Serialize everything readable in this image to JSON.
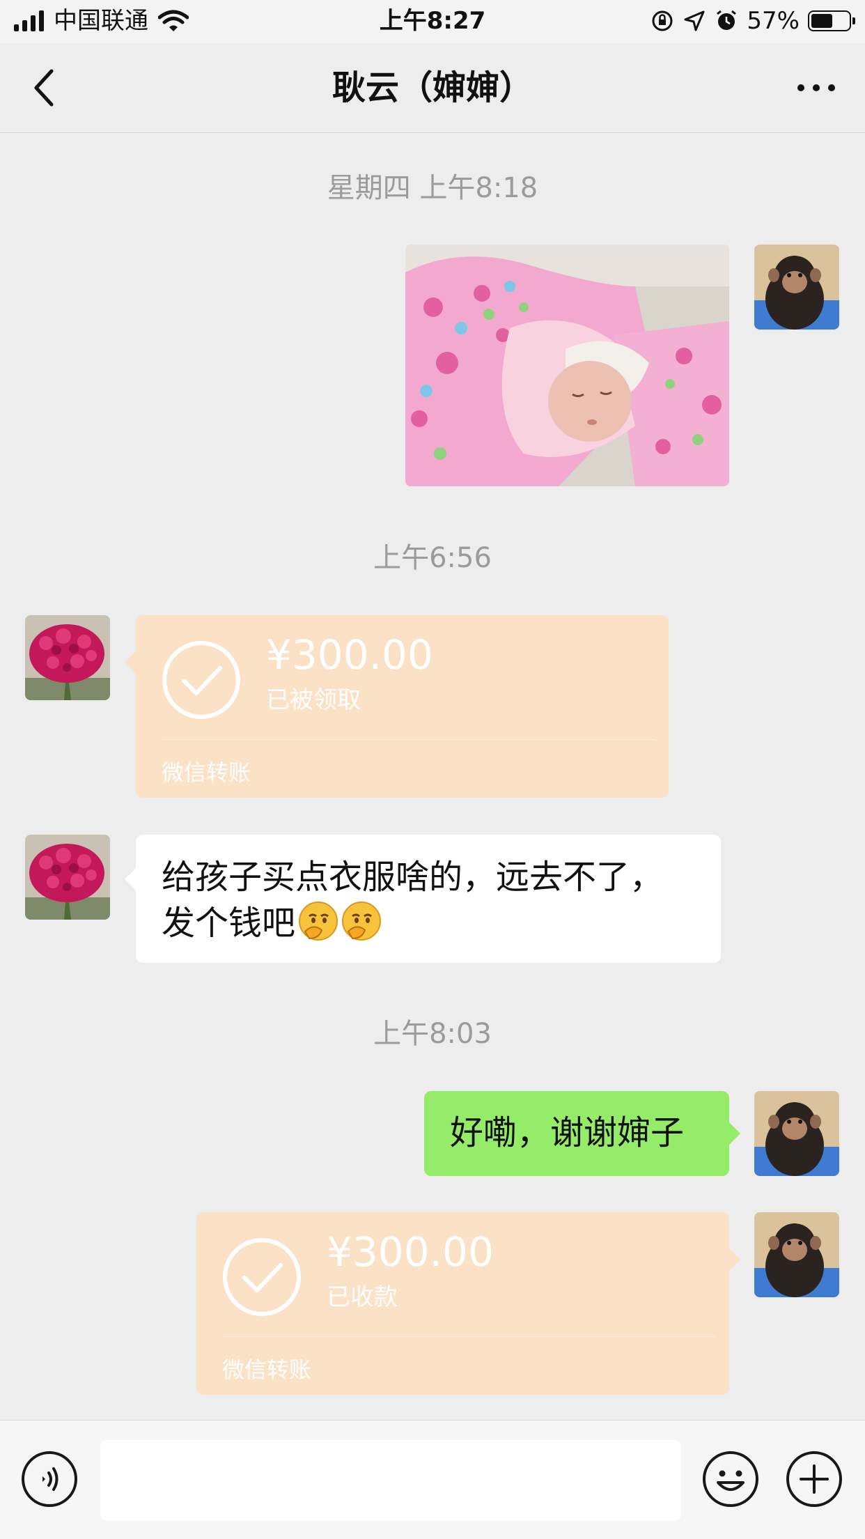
{
  "status_bar": {
    "carrier": "中国联通",
    "time": "上午8:27",
    "battery_percent_text": "57%",
    "battery_level": 0.57
  },
  "nav": {
    "title": "耿云（婶婶）"
  },
  "messages": {
    "ts1": "星期四 上午8:18",
    "ts2": "上午6:56",
    "transfer1": {
      "amount": "¥300.00",
      "status": "已被领取",
      "label": "微信转账"
    },
    "text_in": {
      "line1": "给孩子买点衣服啥的，远去不了，",
      "line2": "发个钱吧"
    },
    "ts3": "上午8:03",
    "text_out": "好嘞，谢谢婶子",
    "transfer2": {
      "amount": "¥300.00",
      "status": "已收款",
      "label": "微信转账"
    }
  },
  "icons": {
    "back": "chevron-left-icon",
    "more": "more-dots-icon",
    "voice": "voice-icon",
    "emoji": "emoji-icon",
    "plus": "plus-icon"
  },
  "colors": {
    "background": "#ededed",
    "transfer_bubble": "#fbe2c6",
    "outgoing_bubble": "#95ec69",
    "incoming_bubble": "#ffffff",
    "timestamp_text": "#9b9b9b"
  }
}
